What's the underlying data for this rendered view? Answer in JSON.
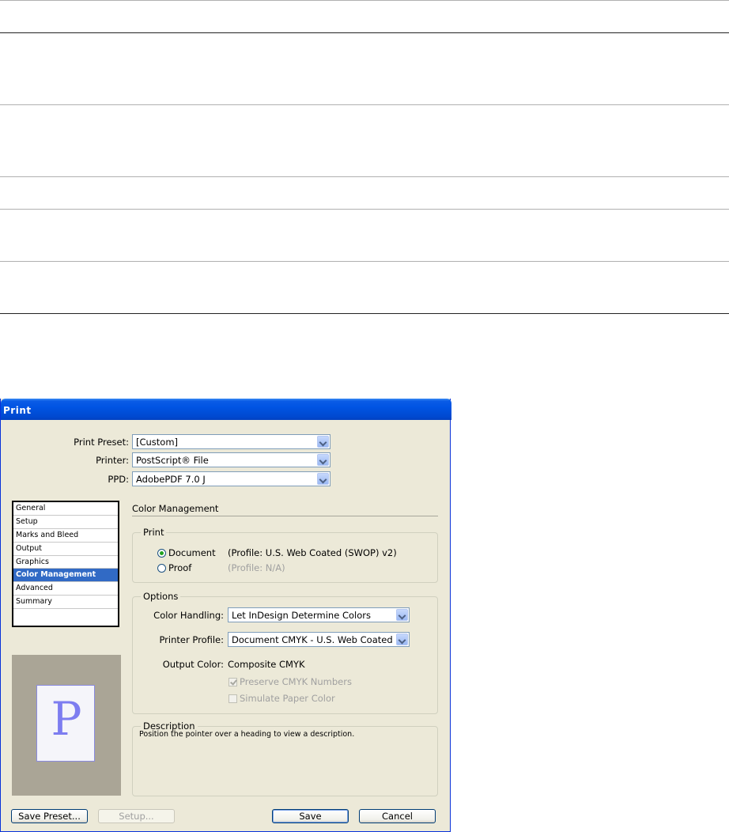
{
  "dialog": {
    "title": "Print",
    "print_preset_label": "Print Preset:",
    "print_preset_value": "[Custom]",
    "printer_label": "Printer:",
    "printer_value": "PostScript® File",
    "ppd_label": "PPD:",
    "ppd_value": "AdobePDF 7.0 J",
    "sidebar": {
      "items": [
        {
          "label": "General"
        },
        {
          "label": "Setup"
        },
        {
          "label": "Marks and Bleed"
        },
        {
          "label": "Output"
        },
        {
          "label": "Graphics"
        },
        {
          "label": "Color Management",
          "selected": true
        },
        {
          "label": "Advanced"
        },
        {
          "label": "Summary"
        }
      ]
    },
    "preview_letter": "P",
    "section_title": "Color Management",
    "print_group": {
      "legend": "Print",
      "document_label": "Document",
      "document_profile": "(Profile: U.S. Web Coated (SWOP) v2)",
      "proof_label": "Proof",
      "proof_profile": "(Profile: N/A)"
    },
    "options_group": {
      "legend": "Options",
      "color_handling_label": "Color Handling:",
      "color_handling_value": "Let InDesign Determine Colors",
      "printer_profile_label": "Printer Profile:",
      "printer_profile_value": "Document CMYK - U.S. Web Coated",
      "output_color_label": "Output Color:",
      "output_color_value": "Composite CMYK",
      "preserve_cmyk_label": "Preserve CMYK Numbers",
      "simulate_paper_label": "Simulate Paper Color"
    },
    "description_group": {
      "legend": "Description",
      "text": "Position the pointer over a heading to view a description."
    },
    "buttons": {
      "save_preset": "Save Preset...",
      "setup": "Setup...",
      "save": "Save",
      "cancel": "Cancel"
    }
  }
}
